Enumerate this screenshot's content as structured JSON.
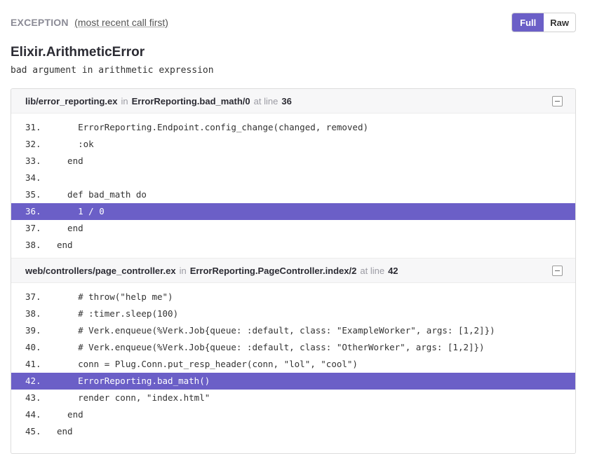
{
  "exception": {
    "title": "EXCEPTION",
    "subtitle": "(most recent call first)",
    "view_buttons": {
      "full": "Full",
      "raw": "Raw",
      "selected": "Full"
    },
    "name": "Elixir.ArithmeticError",
    "message": "bad argument in arithmetic expression"
  },
  "accent_color": "#6b5fc7",
  "frames": [
    {
      "file": "lib/error_reporting.ex",
      "in_label": "in",
      "function": "ErrorReporting.bad_math/0",
      "at_line_label": "at line",
      "line": "36",
      "lines": [
        {
          "num": "31.",
          "code": "    ErrorReporting.Endpoint.config_change(changed, removed)",
          "highlight": false
        },
        {
          "num": "32.",
          "code": "    :ok",
          "highlight": false
        },
        {
          "num": "33.",
          "code": "  end",
          "highlight": false
        },
        {
          "num": "34.",
          "code": "",
          "highlight": false
        },
        {
          "num": "35.",
          "code": "  def bad_math do",
          "highlight": false
        },
        {
          "num": "36.",
          "code": "    1 / 0",
          "highlight": true
        },
        {
          "num": "37.",
          "code": "  end",
          "highlight": false
        },
        {
          "num": "38.",
          "code": "end",
          "highlight": false
        }
      ]
    },
    {
      "file": "web/controllers/page_controller.ex",
      "in_label": "in",
      "function": "ErrorReporting.PageController.index/2",
      "at_line_label": "at line",
      "line": "42",
      "lines": [
        {
          "num": "37.",
          "code": "    # throw(\"help me\")",
          "highlight": false
        },
        {
          "num": "38.",
          "code": "    # :timer.sleep(100)",
          "highlight": false
        },
        {
          "num": "39.",
          "code": "    # Verk.enqueue(%Verk.Job{queue: :default, class: \"ExampleWorker\", args: [1,2]})",
          "highlight": false
        },
        {
          "num": "40.",
          "code": "    # Verk.enqueue(%Verk.Job{queue: :default, class: \"OtherWorker\", args: [1,2]})",
          "highlight": false
        },
        {
          "num": "41.",
          "code": "    conn = Plug.Conn.put_resp_header(conn, \"lol\", \"cool\")",
          "highlight": false
        },
        {
          "num": "42.",
          "code": "    ErrorReporting.bad_math()",
          "highlight": true
        },
        {
          "num": "43.",
          "code": "    render conn, \"index.html\"",
          "highlight": false
        },
        {
          "num": "44.",
          "code": "  end",
          "highlight": false
        },
        {
          "num": "45.",
          "code": "end",
          "highlight": false
        }
      ]
    }
  ]
}
